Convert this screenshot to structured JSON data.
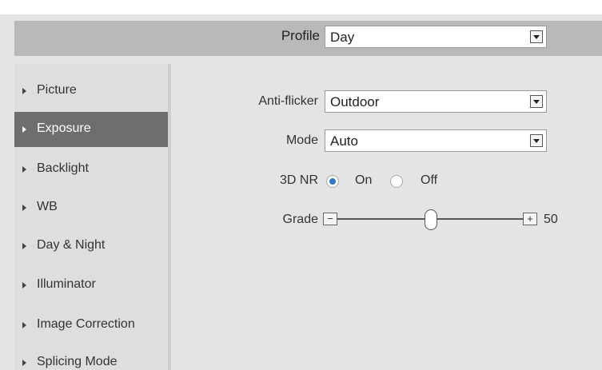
{
  "profile": {
    "label": "Profile",
    "value": "Day"
  },
  "sidebar": {
    "items": [
      {
        "label": "Picture",
        "active": false
      },
      {
        "label": "Exposure",
        "active": true
      },
      {
        "label": "Backlight",
        "active": false
      },
      {
        "label": "WB",
        "active": false
      },
      {
        "label": "Day & Night",
        "active": false
      },
      {
        "label": "Illuminator",
        "active": false
      },
      {
        "label": "Image Correction",
        "active": false
      },
      {
        "label": "Splicing Mode",
        "active": false
      }
    ]
  },
  "form": {
    "anti_flicker": {
      "label": "Anti-flicker",
      "value": "Outdoor"
    },
    "mode": {
      "label": "Mode",
      "value": "Auto"
    },
    "nr3d": {
      "label": "3D NR",
      "on_label": "On",
      "off_label": "Off",
      "selected": "On"
    },
    "grade": {
      "label": "Grade",
      "value": "50",
      "minus": "−",
      "plus": "+"
    }
  },
  "colors": {
    "active_item": "#6e6e6e",
    "radio_checked": "#2e78c8",
    "profile_bar": "#b9b9b9"
  }
}
